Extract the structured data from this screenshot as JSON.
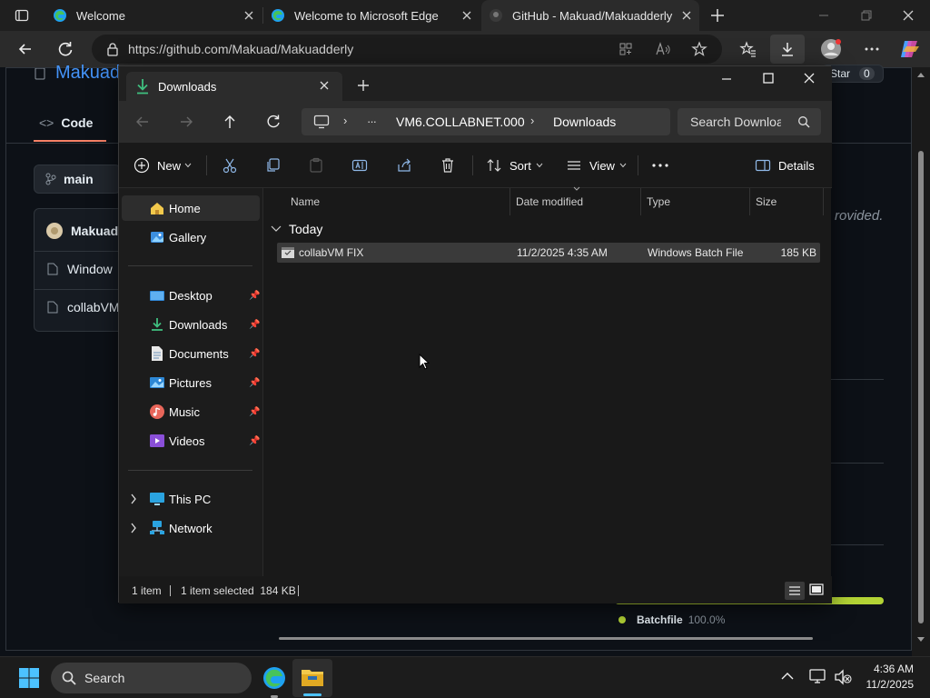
{
  "browser": {
    "tabs": [
      {
        "title": "Welcome"
      },
      {
        "title": "Welcome to Microsoft Edge"
      },
      {
        "title": "GitHub - Makuad/Makuadderly"
      }
    ],
    "url_host": "https://github.com",
    "url_path": "/Makuad/Makuadderly"
  },
  "github": {
    "repo_title": "Makuad",
    "code_tab": "Code",
    "branch": "main",
    "star_label": "Star",
    "star_count": "0",
    "file_owner": "Makuad",
    "files": [
      "Window",
      "collabVM"
    ],
    "about_text": "rovided.",
    "language": {
      "name": "Batchfile",
      "percent": "100.0%"
    }
  },
  "explorer": {
    "tab_title": "Downloads",
    "path": {
      "machine": "VM6.COLLABNET.000",
      "folder": "Downloads",
      "ellipsis": "···"
    },
    "search_placeholder": "Search Downloads",
    "toolbar": {
      "new": "New",
      "sort": "Sort",
      "view": "View",
      "details": "Details",
      "more": "···"
    },
    "nav": {
      "home": "Home",
      "gallery": "Gallery",
      "desktop": "Desktop",
      "downloads": "Downloads",
      "documents": "Documents",
      "pictures": "Pictures",
      "music": "Music",
      "videos": "Videos",
      "this_pc": "This PC",
      "network": "Network"
    },
    "columns": {
      "name": "Name",
      "date": "Date modified",
      "type": "Type",
      "size": "Size"
    },
    "group": "Today",
    "files": [
      {
        "name": "collabVM FIX",
        "date": "11/2/2025 4:35 AM",
        "type": "Windows Batch File",
        "size": "185 KB"
      }
    ],
    "status": {
      "count": "1 item",
      "selected": "1 item selected  184 KB"
    }
  },
  "taskbar": {
    "search": "Search",
    "time": "4:36 AM",
    "date": "11/2/2025"
  },
  "colors": {
    "accent": "#0078d4",
    "edge_blue": "#1ea1f1",
    "folder_yellow": "#f2c94c",
    "batch_green": "#b3d335"
  }
}
